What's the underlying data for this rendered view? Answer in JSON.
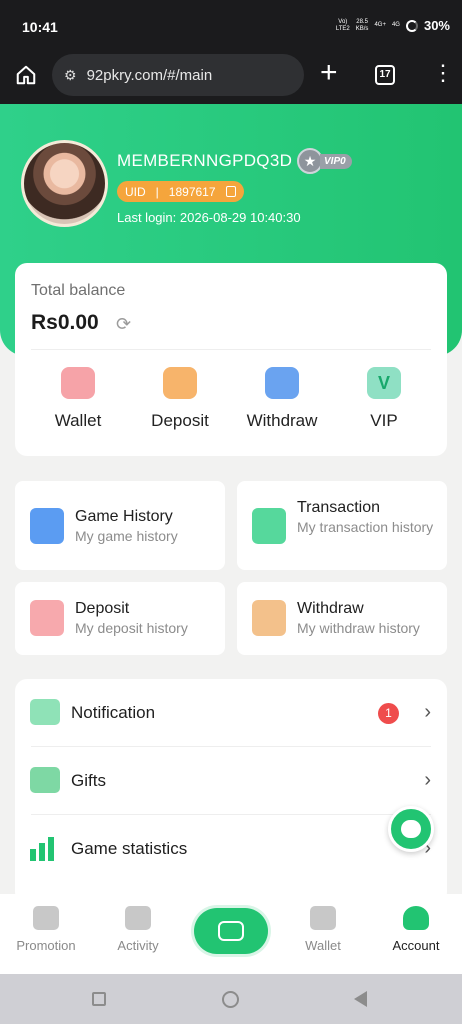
{
  "statusbar": {
    "time": "10:41",
    "volte": "Vo)",
    "lte2": "LTE2",
    "speed": "28.5",
    "speed_unit": "KB/s",
    "net1": "4G+",
    "net2": "4G",
    "battery": "30%"
  },
  "browser": {
    "url": "92pkry.com/#/main",
    "tab_count": "17"
  },
  "profile": {
    "username": "MEMBERNNGPDQ3D",
    "vip_label": "VIP0",
    "uid_label": "UID",
    "uid_sep": "|",
    "uid_value": "1897617",
    "last_login": "Last login: 2026-08-29 10:40:30"
  },
  "balance": {
    "label": "Total balance",
    "amount": "Rs0.00"
  },
  "quick_actions": [
    {
      "label": "Wallet",
      "icon": "wallet-icon"
    },
    {
      "label": "Deposit",
      "icon": "deposit-icon"
    },
    {
      "label": "Withdraw",
      "icon": "withdraw-card-icon"
    },
    {
      "label": "VIP",
      "icon": "vip-gem-icon"
    }
  ],
  "history": {
    "game": {
      "title": "Game History",
      "subtitle": "My game history"
    },
    "transaction": {
      "title": "Transaction",
      "subtitle": "My transaction history"
    },
    "deposit": {
      "title": "Deposit",
      "subtitle": "My deposit history"
    },
    "withdraw": {
      "title": "Withdraw",
      "subtitle": "My withdraw history"
    }
  },
  "menu": {
    "notification": {
      "label": "Notification",
      "badge": "1"
    },
    "gifts": {
      "label": "Gifts"
    },
    "stats": {
      "label": "Game statistics"
    }
  },
  "nav": {
    "promotion": "Promotion",
    "activity": "Activity",
    "wallet": "Wallet",
    "account": "Account"
  },
  "colors": {
    "brand_green": "#22c472",
    "uid_orange": "#f5a53c",
    "badge_red": "#ef4c4c"
  }
}
